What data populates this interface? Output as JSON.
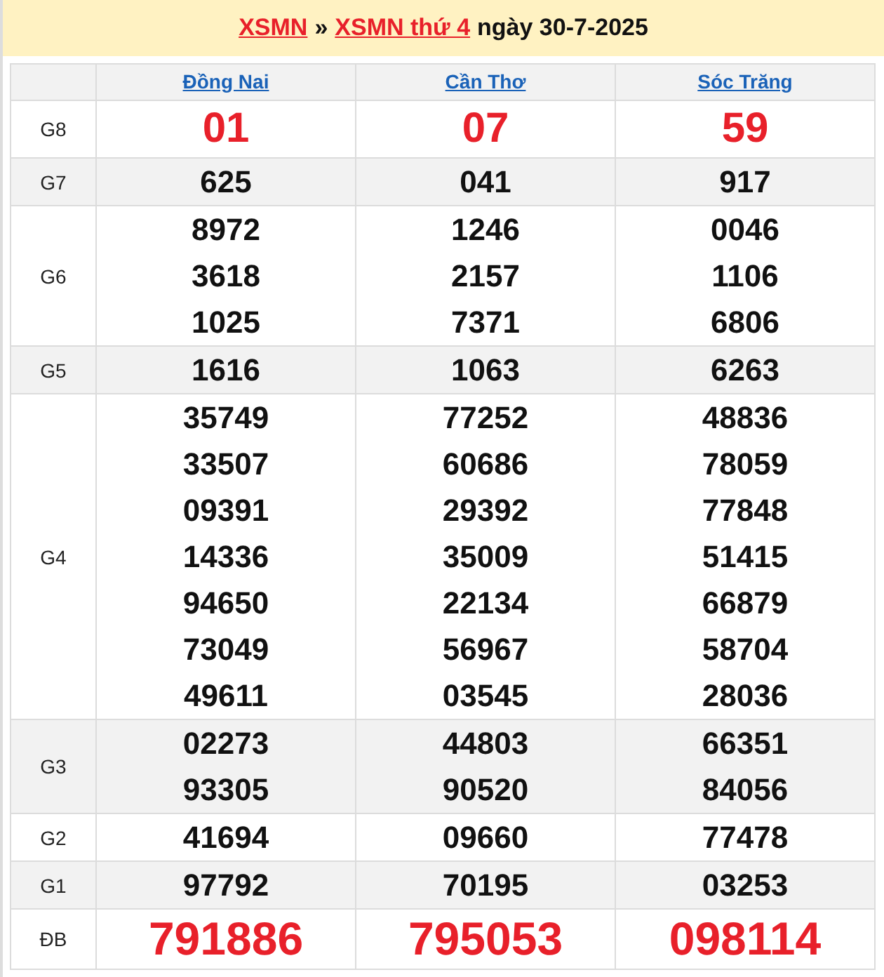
{
  "header": {
    "links": [
      "XSMN",
      "XSMN thứ 4"
    ],
    "separator": "»",
    "date": "ngày 30-7-2025"
  },
  "provinces": [
    "Đồng Nai",
    "Cần Thơ",
    "Sóc Trăng"
  ],
  "prizes": [
    {
      "label": "G8",
      "kind": "highlight",
      "results": [
        [
          "01"
        ],
        [
          "07"
        ],
        [
          "59"
        ]
      ]
    },
    {
      "label": "G7",
      "kind": "normal",
      "results": [
        [
          "625"
        ],
        [
          "041"
        ],
        [
          "917"
        ]
      ]
    },
    {
      "label": "G6",
      "kind": "normal",
      "results": [
        [
          "8972",
          "3618",
          "1025"
        ],
        [
          "1246",
          "2157",
          "7371"
        ],
        [
          "0046",
          "1106",
          "6806"
        ]
      ]
    },
    {
      "label": "G5",
      "kind": "normal",
      "results": [
        [
          "1616"
        ],
        [
          "1063"
        ],
        [
          "6263"
        ]
      ]
    },
    {
      "label": "G4",
      "kind": "normal",
      "results": [
        [
          "35749",
          "33507",
          "09391",
          "14336",
          "94650",
          "73049",
          "49611"
        ],
        [
          "77252",
          "60686",
          "29392",
          "35009",
          "22134",
          "56967",
          "03545"
        ],
        [
          "48836",
          "78059",
          "77848",
          "51415",
          "66879",
          "58704",
          "28036"
        ]
      ]
    },
    {
      "label": "G3",
      "kind": "normal",
      "results": [
        [
          "02273",
          "93305"
        ],
        [
          "44803",
          "90520"
        ],
        [
          "66351",
          "84056"
        ]
      ]
    },
    {
      "label": "G2",
      "kind": "normal",
      "results": [
        [
          "41694"
        ],
        [
          "09660"
        ],
        [
          "77478"
        ]
      ]
    },
    {
      "label": "G1",
      "kind": "normal",
      "results": [
        [
          "97792"
        ],
        [
          "70195"
        ],
        [
          "03253"
        ]
      ]
    },
    {
      "label": "ĐB",
      "kind": "jackpot",
      "results": [
        [
          "791886"
        ],
        [
          "795053"
        ],
        [
          "098114"
        ]
      ]
    }
  ]
}
